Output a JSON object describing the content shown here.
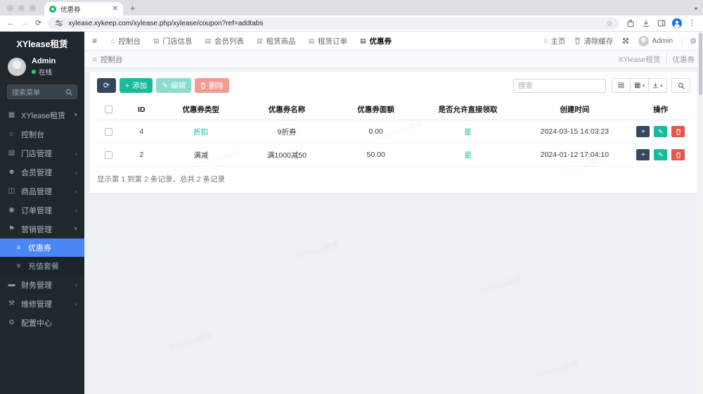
{
  "browser": {
    "tab_title": "优惠券",
    "url": "xylease.xykeep.com/xylease.php/xylease/coupon?ref=addtabs"
  },
  "sidebar": {
    "brand": "XYlease租赁",
    "user": {
      "name": "Admin",
      "status": "在线"
    },
    "search_placeholder": "搜索菜单",
    "menu": [
      {
        "glyph": "▦",
        "label": "XYlease租赁",
        "chev": "▾"
      },
      {
        "glyph": "⌂",
        "label": "控制台",
        "chev": ""
      },
      {
        "glyph": "▤",
        "label": "门店管理",
        "chev": "‹"
      },
      {
        "glyph": "☻",
        "label": "会员管理",
        "chev": "‹"
      },
      {
        "glyph": "◫",
        "label": "商品管理",
        "chev": "‹"
      },
      {
        "glyph": "◉",
        "label": "订单管理",
        "chev": "‹"
      },
      {
        "glyph": "⚑",
        "label": "营销管理",
        "chev": "▾"
      },
      {
        "glyph": "▬",
        "label": "财务管理",
        "chev": "‹"
      },
      {
        "glyph": "⚒",
        "label": "维修管理",
        "chev": "‹"
      },
      {
        "glyph": "⚙",
        "label": "配置中心",
        "chev": ""
      }
    ],
    "submenu": [
      {
        "glyph": "≡",
        "label": "优惠券"
      },
      {
        "glyph": "≡",
        "label": "充值套餐"
      }
    ]
  },
  "topnav": {
    "hamburger": "≡",
    "tabs": [
      {
        "glyph": "⌂",
        "label": "控制台"
      },
      {
        "glyph": "▤",
        "label": "门店信息"
      },
      {
        "glyph": "▤",
        "label": "会员列表"
      },
      {
        "glyph": "▤",
        "label": "租赁商品"
      },
      {
        "glyph": "▤",
        "label": "租赁订单"
      },
      {
        "glyph": "▤",
        "label": "优惠券"
      }
    ],
    "home": "主页",
    "clear_cache": "清除缓存",
    "admin": "Admin",
    "gear": "⚙"
  },
  "breadcrumb": {
    "left": "控制台",
    "parent": "XYlease租赁",
    "current": "优惠券"
  },
  "toolbar": {
    "refresh_glyph": "⟳",
    "add": "添加",
    "edit": "编辑",
    "delete": "删除",
    "search_placeholder": "搜索"
  },
  "table": {
    "columns": [
      "ID",
      "优惠券类型",
      "优惠券名称",
      "优惠券面额",
      "是否允许直接领取",
      "创建时间",
      "操作"
    ],
    "rows": [
      {
        "id": "4",
        "type": "折扣",
        "name": "9折券",
        "amount": "0.00",
        "direct_claim": "是",
        "created": "2024-03-15 14:03:23"
      },
      {
        "id": "2",
        "type": "满减",
        "name": "满1000减50",
        "amount": "50.00",
        "direct_claim": "是",
        "created": "2024-01-12 17:04:10"
      }
    ],
    "summary": "显示第 1 到第 2 条记录，总共 2 条记录"
  },
  "watermark": "XYlease租赁",
  "colors": {
    "accent_green": "#18bc9c",
    "active_blue": "#4a86f6",
    "navy": "#35475c",
    "danger": "#e74c3c"
  }
}
